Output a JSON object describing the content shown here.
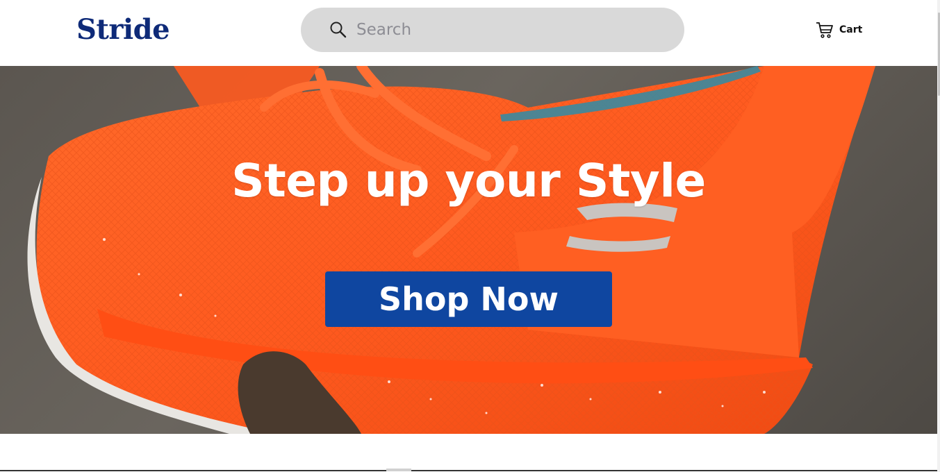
{
  "header": {
    "logo_text": "Stride",
    "search": {
      "placeholder": "Search",
      "value": ""
    },
    "cart_label": "Cart"
  },
  "hero": {
    "title": "Step up your Style",
    "cta_label": "Shop Now",
    "image": "orange-basketball-sneaker-photo"
  },
  "colors": {
    "brand": "#0e2a78",
    "cta": "#0f46a0",
    "search_bg": "#d9d9d9",
    "shoe_orange": "#ff5a1f"
  },
  "icons": [
    "search-icon",
    "cart-icon"
  ]
}
